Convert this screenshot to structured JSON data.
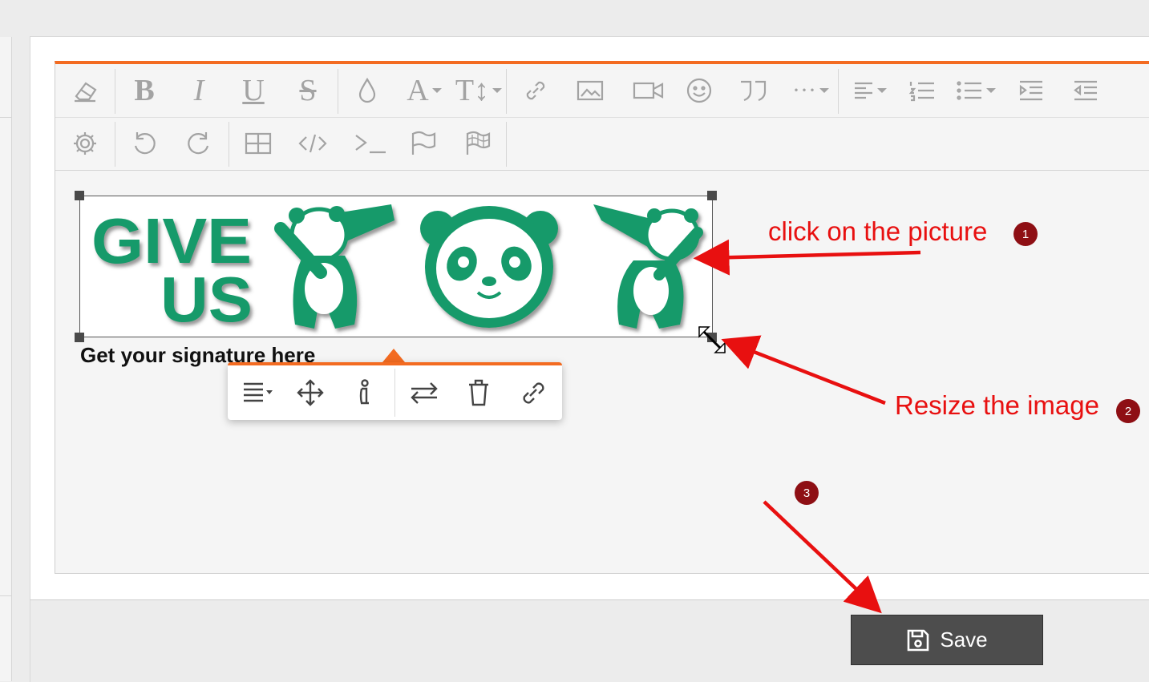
{
  "editor": {
    "accent_color": "#f36b21",
    "toolbar_row1": [
      "eraser-icon",
      "bold-icon",
      "italic-icon",
      "underline-icon",
      "strikethrough-icon",
      "color-drop-icon",
      "font-family-icon",
      "font-size-icon",
      "link-icon",
      "image-icon",
      "video-icon",
      "emoji-icon",
      "quote-icon",
      "more-icon",
      "align-icon",
      "ordered-list-icon",
      "unordered-list-icon",
      "indent-icon",
      "outdent-icon"
    ],
    "toolbar_row2": [
      "settings-icon",
      "undo-icon",
      "redo-icon",
      "table-icon",
      "code-icon",
      "terminal-icon",
      "flag-icon",
      "checkered-flag-icon"
    ]
  },
  "image": {
    "text_line1": "GIVE",
    "text_line2": "US",
    "brand_color": "#139a6a"
  },
  "caption": "Get your signature here",
  "image_popup": {
    "buttons": [
      "align-icon",
      "move-icon",
      "alt-info-icon",
      "replace-icon",
      "delete-icon",
      "link-icon"
    ]
  },
  "annotations": [
    {
      "text": "click on the picture",
      "number": "1"
    },
    {
      "text": "Resize the image",
      "number": "2"
    },
    {
      "text": "",
      "number": "3"
    }
  ],
  "annotation_color": "#e81010",
  "save_button": {
    "label": "Save",
    "icon": "save-icon"
  }
}
